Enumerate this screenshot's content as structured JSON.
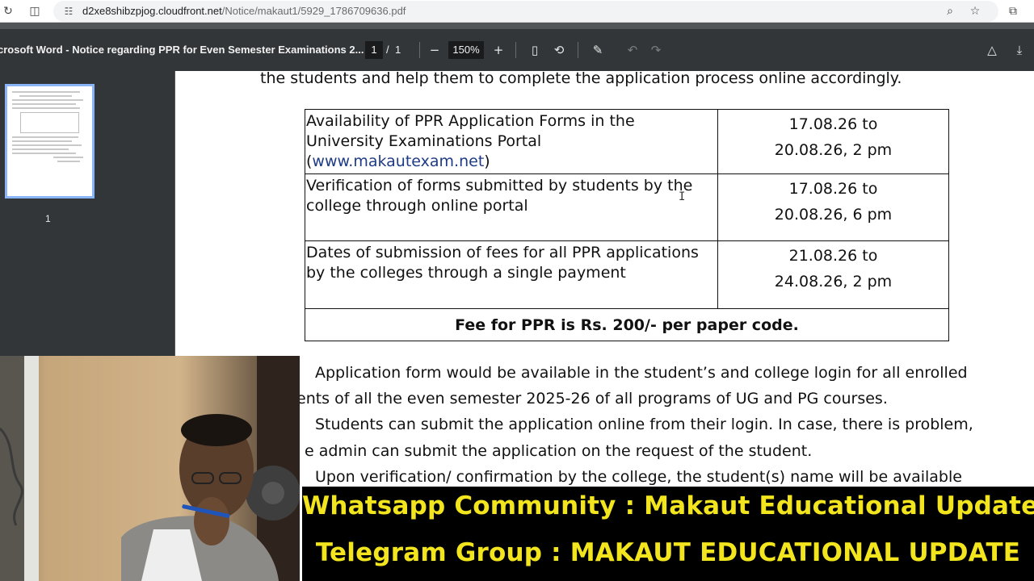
{
  "browser": {
    "url_host": "d2xe8shibzpjog.cloudfront.net",
    "url_path": "/Notice/makaut1/5929_1786709636.pdf",
    "icons": [
      "reload-icon",
      "split-view-icon",
      "site-info-icon",
      "zoom-icon",
      "bookmark-star-icon",
      "extensions-icon"
    ]
  },
  "pdf_toolbar": {
    "doc_title": "crosoft Word - Notice regarding PPR for Even Semester Examinations 2...",
    "current_page": "1",
    "page_separator": "/",
    "total_pages": "1",
    "zoom": "150%",
    "icons": [
      "zoom-out-icon",
      "zoom-in-icon",
      "fit-page-icon",
      "rotate-icon",
      "annotate-icon",
      "undo-icon",
      "redo-icon",
      "drive-save-icon",
      "download-icon"
    ]
  },
  "sidebar": {
    "thumbnail_label": "1"
  },
  "document": {
    "intro_line": "the students and help them to complete the application process online accordingly.",
    "table": {
      "rows": [
        {
          "desc_before_link": "Availability of PPR Application Forms in the University Examinations Portal (",
          "link": "www.makautexam.net",
          "desc_after_link": ")",
          "date_line1": "17.08.26 to",
          "date_line2": "20.08.26, 2 pm"
        },
        {
          "desc": "Verification of forms submitted by students by the college through online portal",
          "date_line1": "17.08.26 to",
          "date_line2": "20.08.26, 6 pm"
        },
        {
          "desc": "Dates of submission of fees for all PPR applications by the colleges through a single payment",
          "date_line1": "21.08.26 to",
          "date_line2": "24.08.26, 2 pm"
        }
      ],
      "fee_note": "Fee for PPR is Rs. 200/- per paper code."
    },
    "paragraphs": [
      "Application form would be available in the student’s and college login for all enrolled",
      "ents of all the even semester 2025-26 of all  programs of UG and PG courses.",
      "Students can submit the application online from their login. In case, there is problem,",
      "e admin can submit the application on the request of the student.",
      "Upon verification/ confirmation by the college, the student(s) name will be available"
    ]
  },
  "banner": {
    "line1": "Whatsapp Community : Makaut Educational Update",
    "line2": "Telegram Group : MAKAUT EDUCATIONAL UPDATE"
  },
  "colors": {
    "toolbar_bg": "#323639",
    "banner_bg": "#000000",
    "banner_text": "#f2e41d",
    "link": "#1f3b86",
    "thumbnail_border": "#8ab4f8"
  }
}
